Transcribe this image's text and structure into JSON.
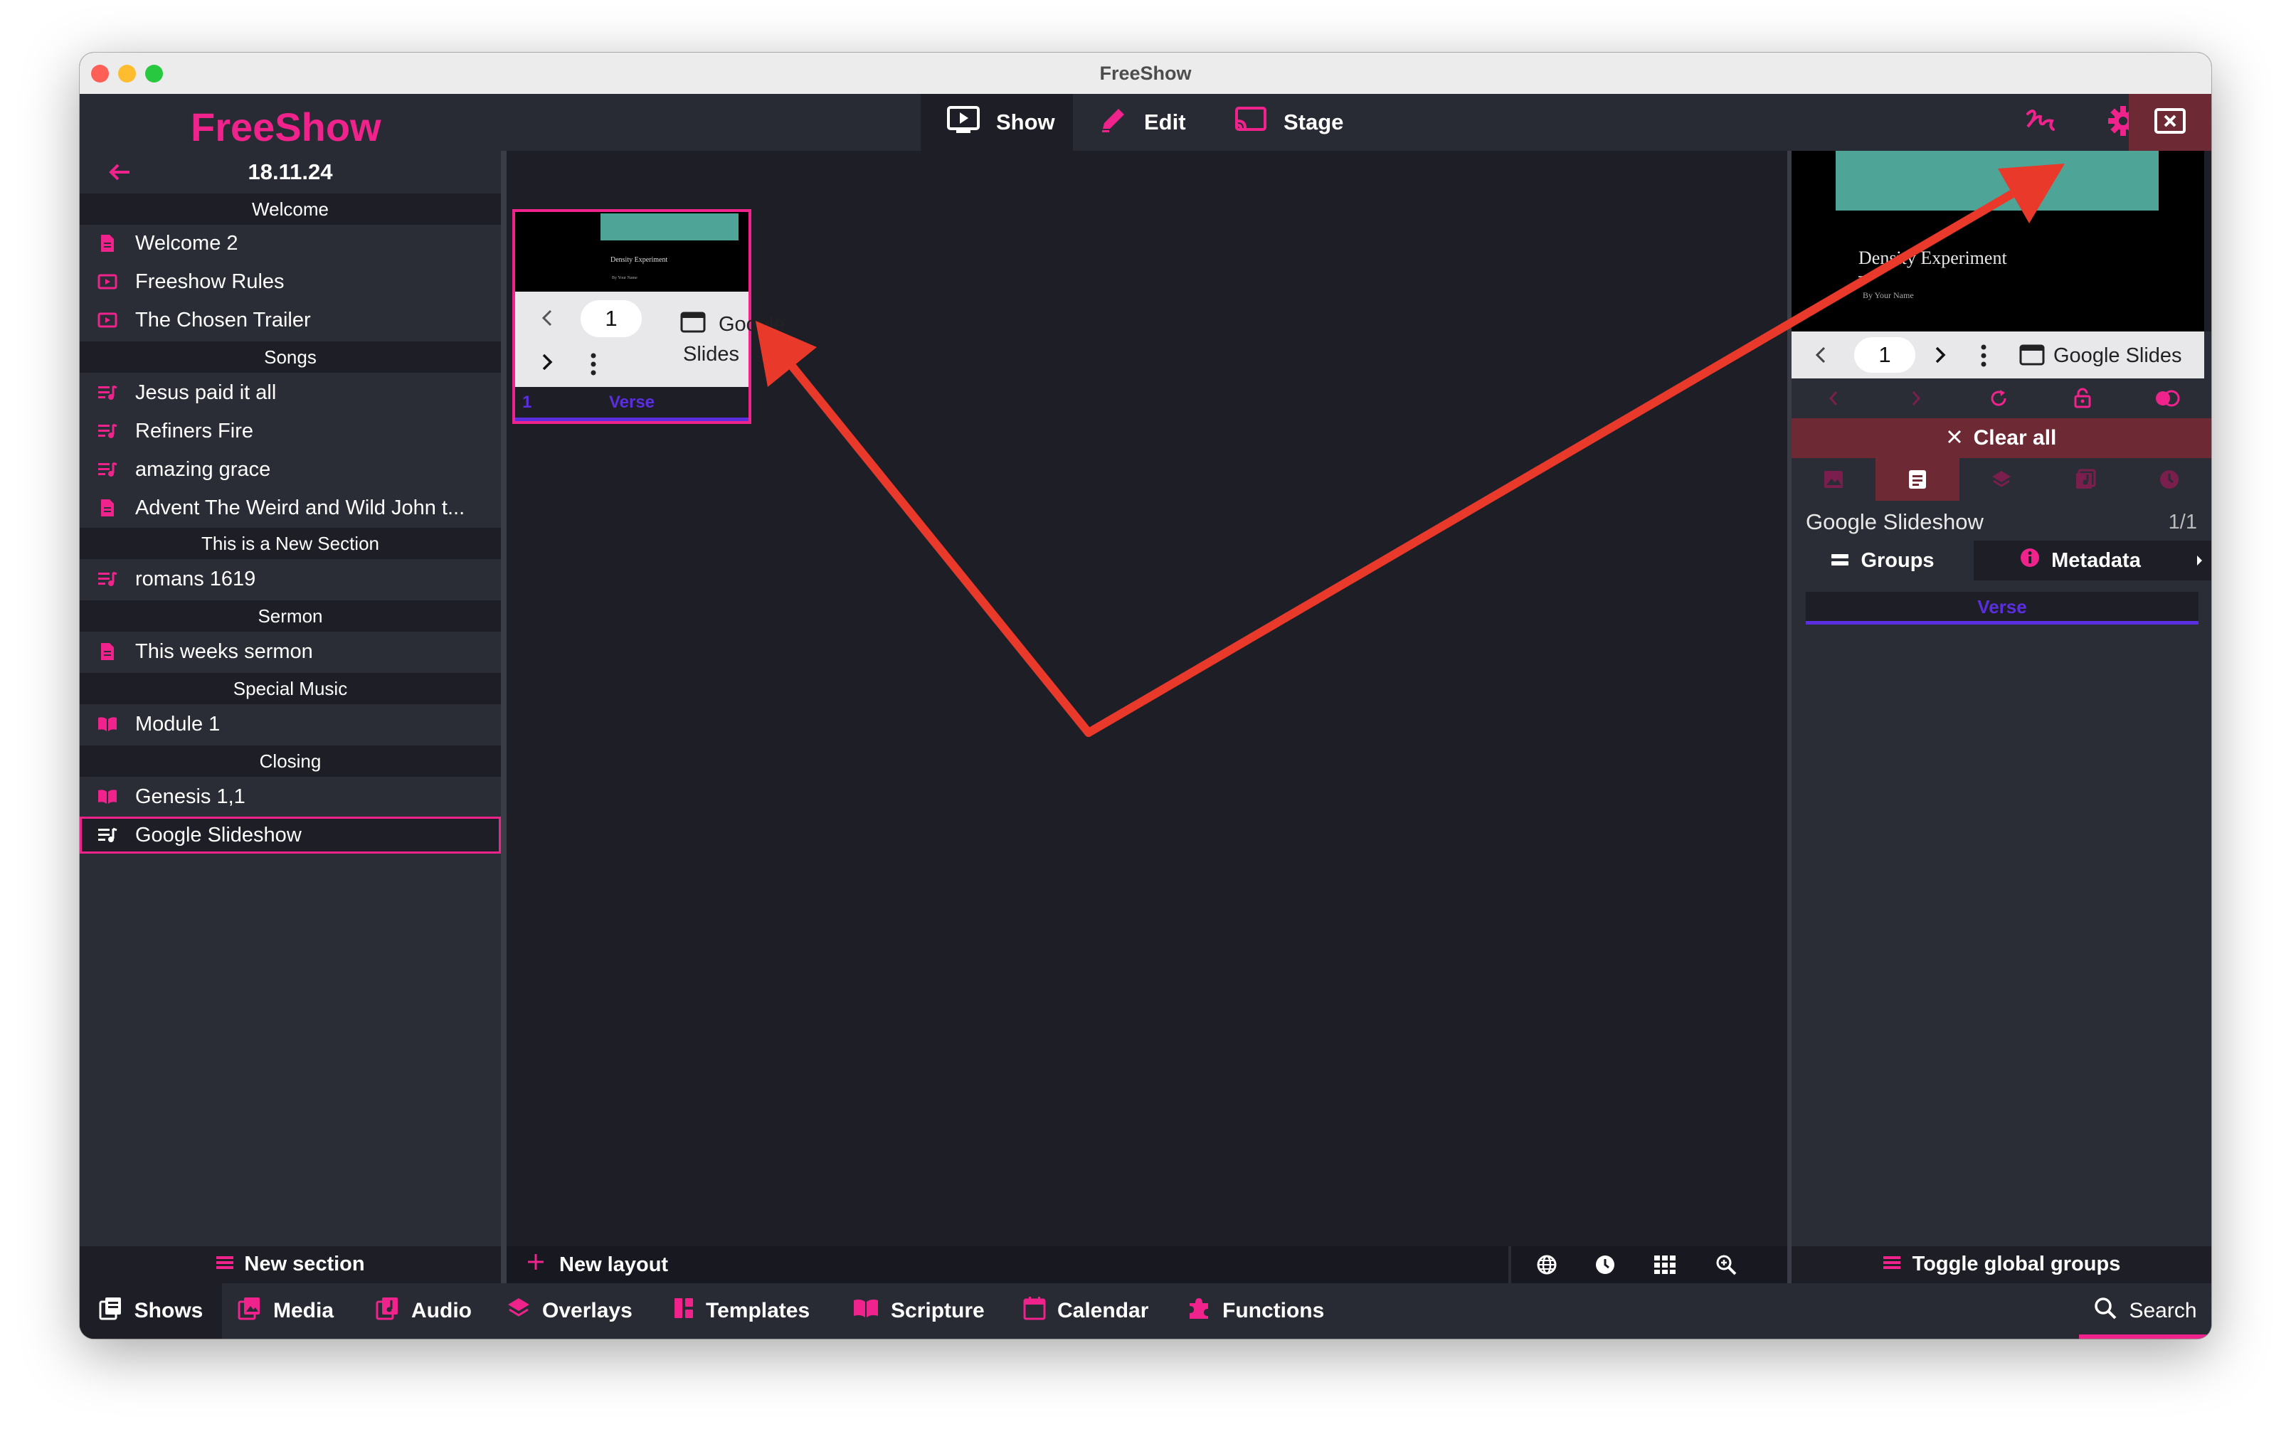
{
  "window": {
    "title": "FreeShow"
  },
  "app": {
    "logo": "FreeShow"
  },
  "main_tabs": [
    {
      "label": "Show",
      "icon": "play-icon"
    },
    {
      "label": "Edit",
      "icon": "pencil-icon"
    },
    {
      "label": "Stage",
      "icon": "cast-icon"
    }
  ],
  "top_icons": [
    "draw-icon",
    "gear-icon",
    "close-window-icon"
  ],
  "project": {
    "date": "18.11.24",
    "back_icon": "arrow-left-icon",
    "sections": [
      "Welcome",
      "Songs",
      "This is a New Section",
      "Sermon",
      "Special Music",
      "Closing"
    ],
    "items": [
      {
        "label": "Welcome 2",
        "icon": "document-icon"
      },
      {
        "label": "Freeshow Rules",
        "icon": "video-icon"
      },
      {
        "label": "The Chosen Trailer",
        "icon": "video-icon"
      },
      {
        "label": "Jesus paid it all",
        "icon": "lyrics-icon"
      },
      {
        "label": "Refiners Fire",
        "icon": "lyrics-icon"
      },
      {
        "label": "amazing grace",
        "icon": "lyrics-icon"
      },
      {
        "label": "Advent The Weird and Wild John t...",
        "icon": "document-icon"
      },
      {
        "label": "romans 1619",
        "icon": "lyrics-icon"
      },
      {
        "label": "This weeks sermon",
        "icon": "document-icon"
      },
      {
        "label": "Module 1",
        "icon": "book-icon"
      },
      {
        "label": "Genesis 1,1",
        "icon": "book-icon"
      },
      {
        "label": "Google Slideshow",
        "icon": "lyrics-icon"
      }
    ],
    "new_section": "New section"
  },
  "slide": {
    "preview_title": "Density Experiment",
    "preview_subtitle": "By Your Name",
    "page": "1",
    "google_label_line1": "Google",
    "google_label_line2": "Slides",
    "number": "1",
    "group": "Verse"
  },
  "center_bar": {
    "new_layout": "New layout",
    "tools": [
      "globe-icon",
      "clock-icon",
      "grid-icon",
      "zoom-icon"
    ]
  },
  "preview": {
    "title": "Density Experiment",
    "subtitle": "By Your Name",
    "page": "1",
    "google_label": "Google Slides",
    "clear_all": "Clear all",
    "show_name": "Google Slideshow",
    "slide_count": "1/1",
    "tab_groups": "Groups",
    "tab_metadata": "Metadata",
    "group": "Verse",
    "toggle_global_groups": "Toggle global groups"
  },
  "bottom_tabs": [
    {
      "label": "Shows",
      "icon": "shows-icon"
    },
    {
      "label": "Media",
      "icon": "image-icon"
    },
    {
      "label": "Audio",
      "icon": "music-icon"
    },
    {
      "label": "Overlays",
      "icon": "layers-icon"
    },
    {
      "label": "Templates",
      "icon": "templates-icon"
    },
    {
      "label": "Scripture",
      "icon": "book-icon"
    },
    {
      "label": "Calendar",
      "icon": "calendar-icon"
    },
    {
      "label": "Functions",
      "icon": "puzzle-icon"
    }
  ],
  "search": {
    "label": "Search"
  },
  "colors": {
    "accent": "#f0238c",
    "verse": "#5b2fe0",
    "annotation": "#e8392b",
    "slide_teal": "#4ea597"
  }
}
